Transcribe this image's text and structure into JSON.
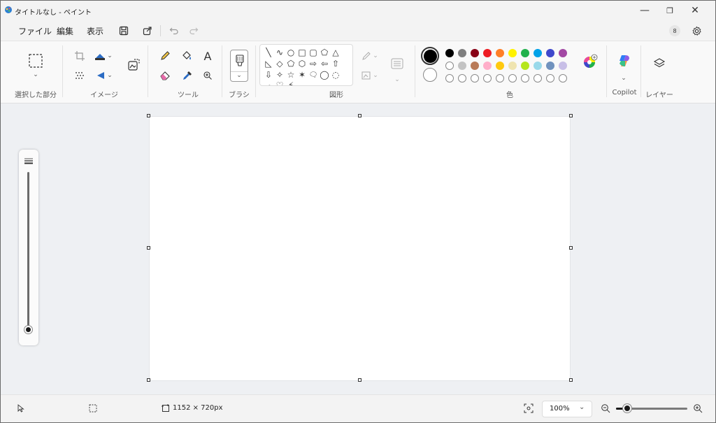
{
  "window": {
    "title": "タイトルなし - ペイント",
    "minimize_glyph": "—",
    "restore_glyph": "❐",
    "close_glyph": "✕"
  },
  "menu": {
    "items": [
      "ファイル",
      "編集",
      "表示"
    ]
  },
  "user": {
    "avatar_label": "8"
  },
  "ribbon": {
    "groups": {
      "selection": "選択した部分",
      "image": "イメージ",
      "tools": "ツール",
      "brush": "ブラシ",
      "shapes": "図形",
      "colors": "色",
      "copilot": "Copilot",
      "layers": "レイヤー"
    },
    "text_tool_glyph": "A",
    "shapes": [
      "╲",
      "∿",
      "○",
      "□",
      "▢",
      "⬠",
      "△",
      "◺",
      "◇",
      "⬠",
      "⬡",
      "⇨",
      "⇦",
      "⇧",
      "⇩",
      "✧",
      "☆",
      "✶",
      "🗨",
      "◯",
      "◌",
      "☁",
      "♡",
      "⚡"
    ],
    "colors": {
      "primary": "#000000",
      "secondary": "#ffffff",
      "row1": [
        "#000000",
        "#7f7f7f",
        "#880015",
        "#ed1c24",
        "#ff7f27",
        "#fff200",
        "#22b14c",
        "#00a2e8",
        "#3f48cc",
        "#a349a4"
      ],
      "row2": [
        "empty",
        "#c3c3c3",
        "#b97a57",
        "#ffaec9",
        "#ffc90e",
        "#efe4b0",
        "#b5e61d",
        "#99d9ea",
        "#7092be",
        "#c8bfe7"
      ],
      "row3": [
        "empty",
        "empty",
        "empty",
        "empty",
        "empty",
        "empty",
        "empty",
        "empty",
        "empty",
        "empty"
      ]
    }
  },
  "status": {
    "canvas_size": "1152 × 720px",
    "zoom": "100%"
  }
}
